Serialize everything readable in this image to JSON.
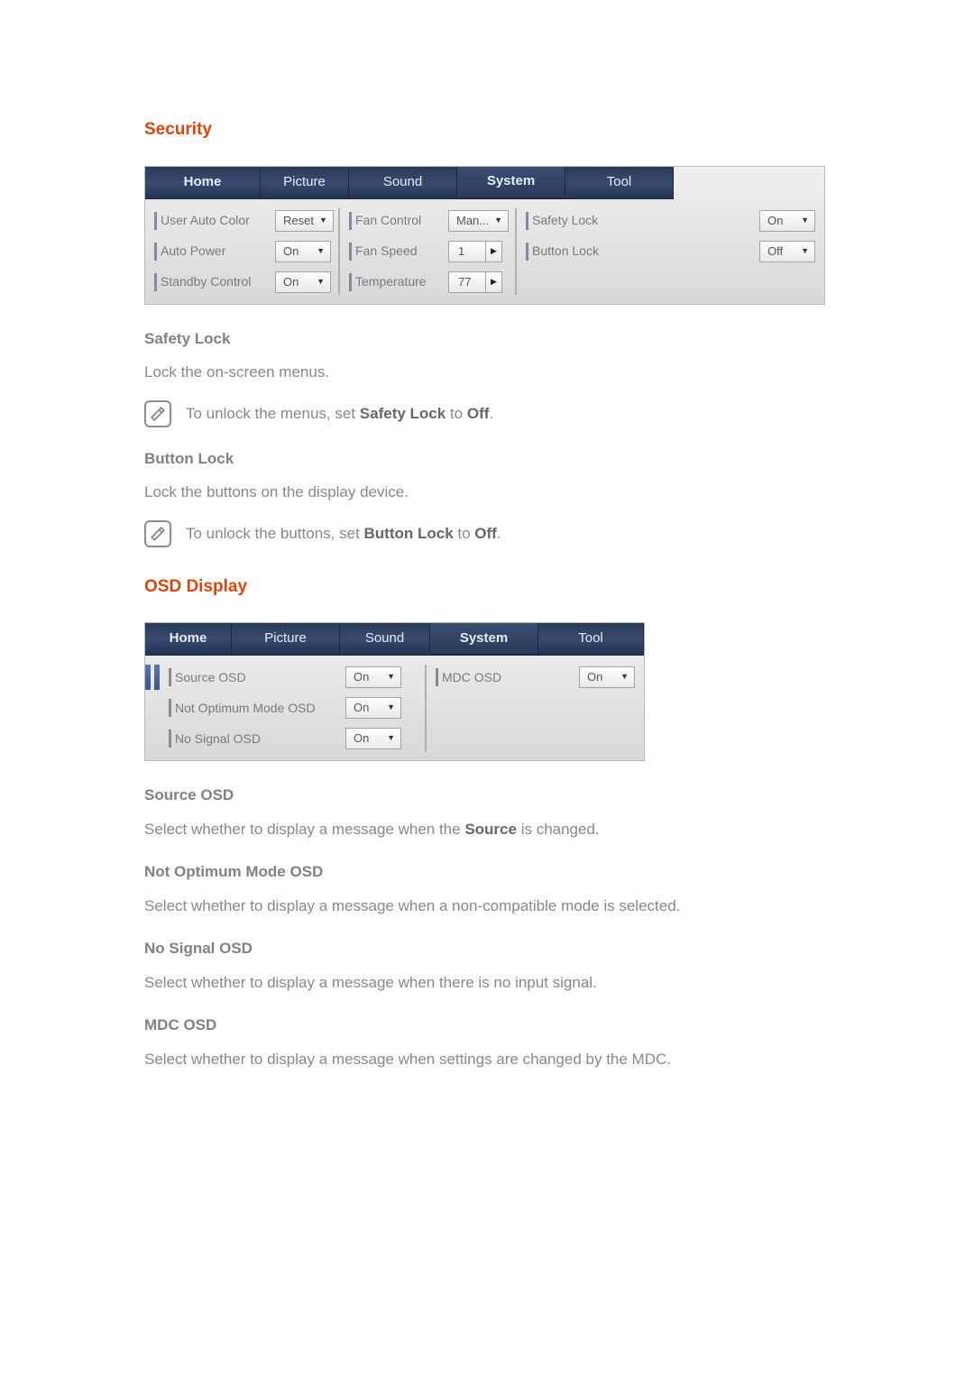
{
  "headings": {
    "security": "Security",
    "osd": "OSD Display"
  },
  "tabs": {
    "home": "Home",
    "picture": "Picture",
    "sound": "Sound",
    "system": "System",
    "tool": "Tool"
  },
  "panel1": {
    "group1": {
      "user_auto_color": {
        "label": "User Auto Color",
        "value": "Reset"
      },
      "auto_power": {
        "label": "Auto Power",
        "value": "On"
      },
      "standby_control": {
        "label": "Standby Control",
        "value": "On"
      }
    },
    "group2": {
      "fan_control": {
        "label": "Fan Control",
        "value": "Man..."
      },
      "fan_speed": {
        "label": "Fan Speed",
        "value": "1"
      },
      "temperature": {
        "label": "Temperature",
        "value": "77"
      }
    },
    "group3": {
      "safety_lock": {
        "label": "Safety Lock",
        "value": "On"
      },
      "button_lock": {
        "label": "Button Lock",
        "value": "Off"
      }
    }
  },
  "panel2": {
    "source_osd": {
      "label": "Source OSD",
      "value": "On"
    },
    "not_optimum_osd": {
      "label": "Not Optimum Mode OSD",
      "value": "On"
    },
    "no_signal_osd": {
      "label": "No Signal OSD",
      "value": "On"
    },
    "mdc_osd": {
      "label": "MDC OSD",
      "value": "On"
    }
  },
  "text": {
    "safety_lock_h": "Safety Lock",
    "safety_lock_p": "Lock the on-screen menus.",
    "safety_note_1": "To unlock the menus, set ",
    "safety_note_b": "Safety Lock",
    "safety_note_2": " to ",
    "safety_note_b2": "Off",
    "safety_note_3": ".",
    "button_lock_h": "Button Lock",
    "button_lock_p": "Lock the buttons on the display device.",
    "button_note_1": "To unlock the buttons, set ",
    "button_note_b": "Button Lock",
    "button_note_2": " to ",
    "button_note_b2": "Off",
    "button_note_3": ".",
    "source_osd_h": "Source OSD",
    "source_osd_p1": "Select whether to display a message when the ",
    "source_osd_b": "Source",
    "source_osd_p2": " is changed.",
    "not_opt_h": "Not Optimum Mode OSD",
    "not_opt_p": "Select whether to display a message when a non-compatible mode is selected.",
    "no_signal_h": "No Signal OSD",
    "no_signal_p": "Select whether to display a message when there is no input signal.",
    "mdc_h": "MDC OSD",
    "mdc_p": "Select whether to display a message when settings are changed by the MDC."
  }
}
